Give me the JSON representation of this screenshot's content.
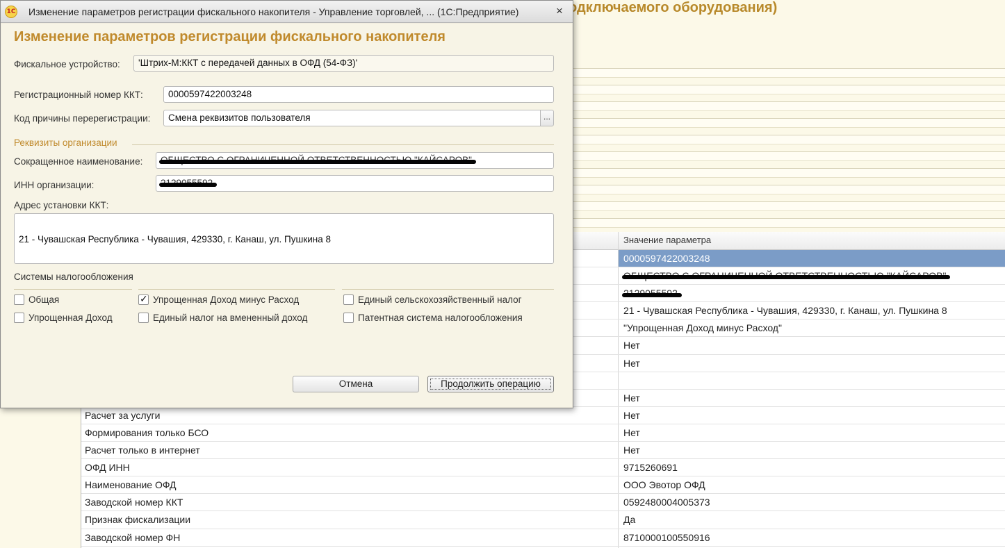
{
  "background": {
    "title_fragment": "одключаемого оборудования)",
    "table": {
      "value_header": "Значение параметра",
      "rows": [
        {
          "name": "",
          "value": "0000597422003248",
          "selected": true
        },
        {
          "name": "",
          "value": "ОБЩЕСТВО С ОГРАНИЧЕННОЙ ОТВЕТСТВЕННОСТЬЮ \"КАЙСАРОВ\"",
          "redacted": true
        },
        {
          "name": "",
          "value": "2129055592",
          "redacted": true
        },
        {
          "name": "",
          "value": "21 - Чувашская Республика - Чувашия, 429330, г. Канаш, ул. Пушкина  8"
        },
        {
          "name": "",
          "value": "\"Упрощенная Доход минус Расход\""
        },
        {
          "name": "",
          "value": "Нет"
        },
        {
          "name": "",
          "value": "Нет"
        },
        {
          "name": "",
          "value": ""
        },
        {
          "name": "",
          "value": "Нет"
        },
        {
          "name": "Расчет за услуги",
          "value": "Нет"
        },
        {
          "name": "Формирования только БСО",
          "value": "Нет"
        },
        {
          "name": "Расчет только в интернет",
          "value": "Нет"
        },
        {
          "name": "ОФД ИНН",
          "value": "9715260691"
        },
        {
          "name": "Наименование ОФД",
          "value": "ООО  Эвотор ОФД"
        },
        {
          "name": "Заводской номер ККТ",
          "value": "0592480004005373"
        },
        {
          "name": "Признак фискализации",
          "value": "Да"
        },
        {
          "name": "Заводской номер ФН",
          "value": "8710000100550916"
        }
      ]
    }
  },
  "dialog": {
    "window_title": "Изменение параметров регистрации фискального накопителя - Управление торговлей, ...  (1С:Предприятие)",
    "app_logo": "1С",
    "close_icon": "×",
    "heading": "Изменение параметров регистрации фискального накопителя",
    "fiscal_device_label": "Фискальное устройство:",
    "fiscal_device_value": "'Штрих-М:ККТ с передачей данных в ОФД (54-ФЗ)'",
    "reg_number_label": "Регистрационный номер ККТ:",
    "reg_number_value": "0000597422003248",
    "reason_label": "Код причины перерегистрации:",
    "reason_value": "Смена реквизитов пользователя",
    "select_button": "...",
    "org_group_title": "Реквизиты организации",
    "short_name_label": "Сокращенное наименование:",
    "short_name_value": "ОБЩЕСТВО С ОГРАНИЧЕННОЙ ОТВЕТСТВЕННОСТЬЮ \"КАЙСАРОВ\"",
    "inn_label": "ИНН организации:",
    "inn_value": "2129055592",
    "address_label": "Адрес установки ККТ:",
    "address_value": "21 - Чувашская Республика - Чувашия, 429330, г. Канаш, ул. Пушкина  8",
    "tax_group_title": "Системы налогообложения",
    "tax_systems": [
      {
        "label": "Общая",
        "checked": false
      },
      {
        "label": "Упрощенная Доход",
        "checked": false
      },
      {
        "label": "Упрощенная Доход минус Расход",
        "checked": true
      },
      {
        "label": "Единый налог на вмененный доход",
        "checked": false
      },
      {
        "label": "Единый сельскохозяйственный налог",
        "checked": false
      },
      {
        "label": "Патентная система налогообложения",
        "checked": false
      }
    ],
    "cancel_button": "Отмена",
    "continue_button": "Продолжить операцию"
  }
}
